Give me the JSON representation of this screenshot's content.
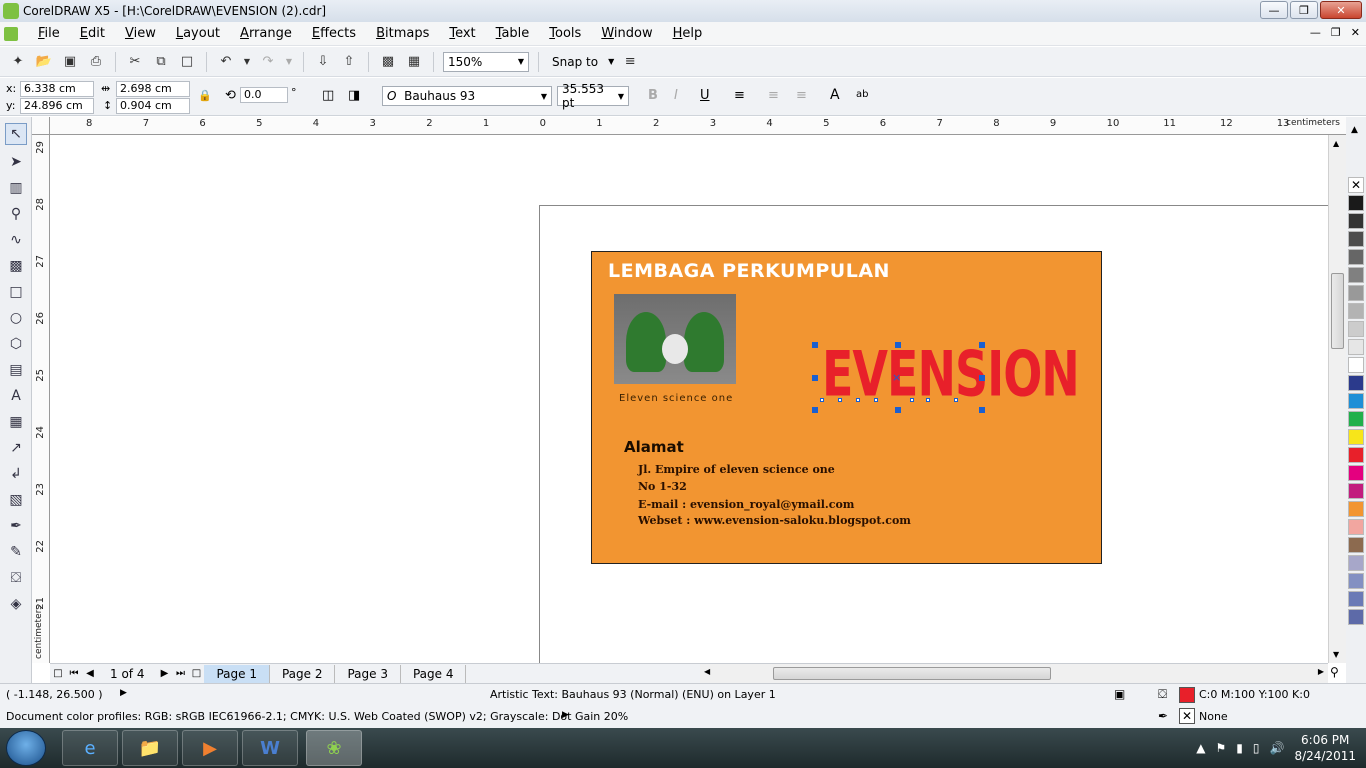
{
  "window": {
    "title": "CorelDRAW X5 - [H:\\CorelDRAW\\EVENSION (2).cdr]"
  },
  "menu": [
    "File",
    "Edit",
    "View",
    "Layout",
    "Arrange",
    "Effects",
    "Bitmaps",
    "Text",
    "Table",
    "Tools",
    "Window",
    "Help"
  ],
  "toolbar": {
    "zoom": "150%",
    "snap_to": "Snap to"
  },
  "properties": {
    "x": "6.338 cm",
    "y": "24.896 cm",
    "width": "2.698 cm",
    "height": "0.904 cm",
    "x_label": "x:",
    "y_label": "y:",
    "rotation": "0.0",
    "degree": "°",
    "font": "Bauhaus 93",
    "font_size": "35.553 pt"
  },
  "rulers": {
    "unit": "centimeters",
    "h_ticks": [
      "8",
      "7",
      "6",
      "5",
      "4",
      "3",
      "2",
      "1",
      "0",
      "1",
      "2",
      "3",
      "4",
      "5",
      "6",
      "7",
      "8",
      "9",
      "10",
      "11",
      "12",
      "13"
    ],
    "v_ticks": [
      "29",
      "28",
      "27",
      "26",
      "25",
      "24",
      "23",
      "22",
      "21"
    ]
  },
  "card": {
    "title": "LEMBAGA PERKUMPULAN",
    "photo_caption": "Eleven science one",
    "logo": "EVENSION",
    "address_heading": "Alamat",
    "address_lines": [
      "Jl. Empire of eleven science one",
      "No 1-32",
      "E-mail : evension_royal@ymail.com",
      "Webset : www.evension-saloku.blogspot.com"
    ]
  },
  "pages": {
    "count": "1 of 4",
    "tabs": [
      "Page 1",
      "Page 2",
      "Page 3",
      "Page 4"
    ]
  },
  "status": {
    "coords": "( -1.148, 26.500 )",
    "selection": "Artistic Text: Bauhaus 93 (Normal) (ENU) on Layer 1",
    "fill": "C:0 M:100 Y:100 K:0",
    "outline": "None",
    "color_profiles": "Document color profiles: RGB: sRGB IEC61966-2.1; CMYK: U.S. Web Coated (SWOP) v2; Grayscale: Dot Gain 20%"
  },
  "colors": {
    "card_bg": "#f29531",
    "logo": "#e8202a",
    "fill_swatch": "#e8202a"
  },
  "palette": [
    "#1a1a1a",
    "#333333",
    "#4d4d4d",
    "#666666",
    "#808080",
    "#999999",
    "#b3b3b3",
    "#cccccc",
    "#e6e6e6",
    "#ffffff",
    "#2b3a8c",
    "#1e8fd6",
    "#20b04b",
    "#f7e51a",
    "#e8202a",
    "#e4007f",
    "#c21d7e",
    "#f29531",
    "#f2a6a0",
    "#8c6a4f",
    "#a7a7c9",
    "#8390c2",
    "#6a7ab6",
    "#5d6aa8"
  ],
  "taskbar": {
    "time": "6:06 PM",
    "date": "8/24/2011",
    "apps": [
      "IE",
      "Explorer",
      "Media",
      "Word",
      "CorelDRAW"
    ]
  }
}
